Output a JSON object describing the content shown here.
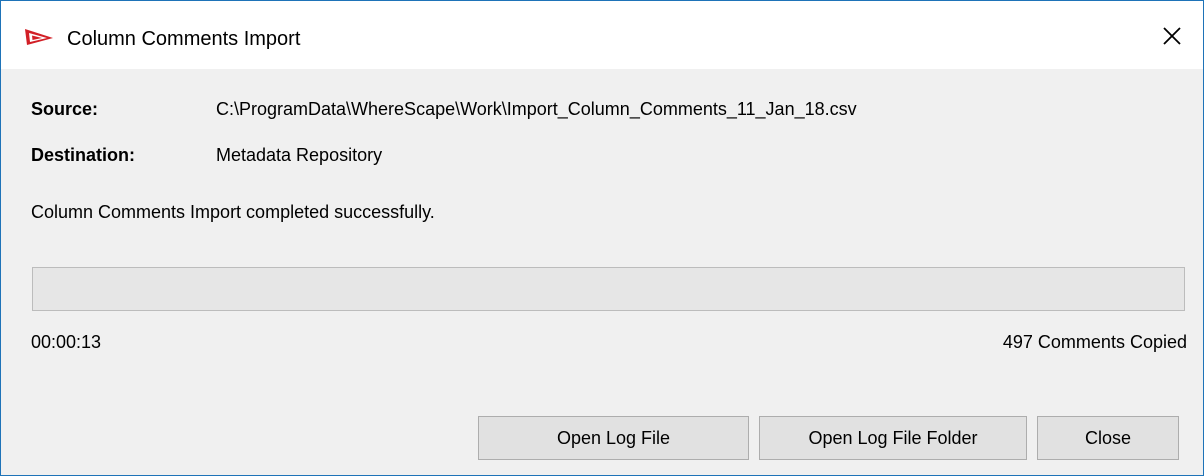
{
  "window": {
    "title": "Column Comments Import",
    "app_icon": "wherescape-red-logo-icon",
    "close_icon": "close-icon",
    "border_color": "#1e73b8"
  },
  "info": {
    "source_label": "Source:",
    "source_value": "C:\\ProgramData\\WhereScape\\Work\\Import_Column_Comments_11_Jan_18.csv",
    "destination_label": "Destination:",
    "destination_value": "Metadata Repository"
  },
  "status": {
    "message": "Column Comments Import completed successfully.",
    "progress_fraction": 0,
    "elapsed_time": "00:00:13",
    "count_text": "497 Comments Copied"
  },
  "buttons": {
    "open_log_file": "Open Log File",
    "open_log_folder": "Open Log File Folder",
    "close": "Close"
  }
}
